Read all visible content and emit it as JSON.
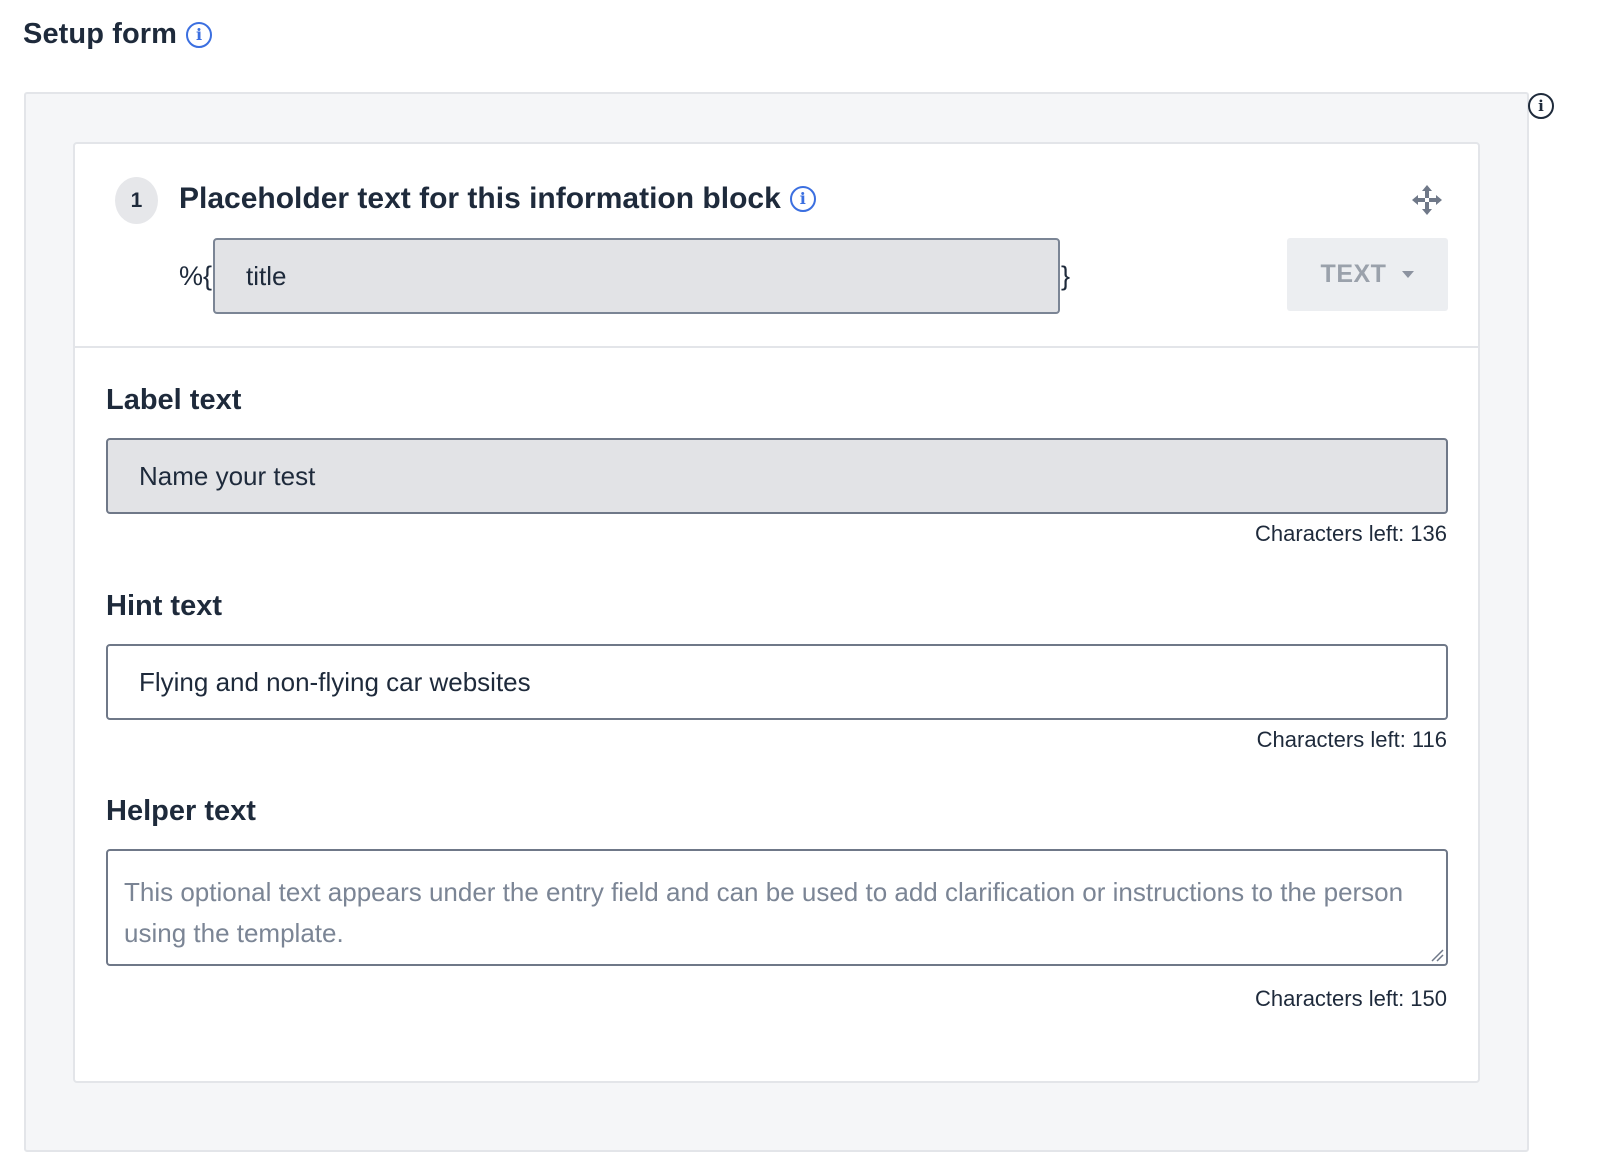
{
  "header": {
    "title": "Setup form",
    "info_icon": "info-icon"
  },
  "side_info_icon": "info-icon",
  "block": {
    "number": "1",
    "title": "Placeholder text for this information block",
    "title_info_icon": "info-icon",
    "move_icon": "move-icon",
    "placeholder": {
      "prefix": "%{",
      "value": "title",
      "suffix": "}"
    },
    "type_select": {
      "value": "TEXT",
      "caret_icon": "caret-down-icon"
    }
  },
  "fields": {
    "label": {
      "label": "Label text",
      "value": "Name your test",
      "chars_left": "Characters left: 136"
    },
    "hint": {
      "label": "Hint text",
      "value": "Flying and non-flying car websites",
      "chars_left": "Characters left: 116"
    },
    "helper": {
      "label": "Helper text",
      "value": "",
      "placeholder": "This optional text appears under the entry field and can be used to add clarification or instructions to the person using the template.",
      "chars_left": "Characters left: 150"
    }
  },
  "colors": {
    "accent": "#3b6fe0",
    "text": "#1e2a3b",
    "panel_bg": "#f5f6f8",
    "input_disabled_bg": "#e2e3e6"
  }
}
